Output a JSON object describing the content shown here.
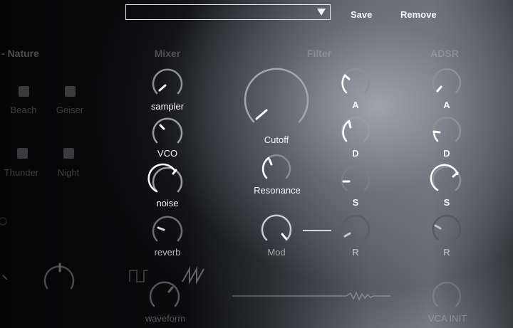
{
  "toolbar": {
    "preset_value": "",
    "save_label": "Save",
    "remove_label": "Remove"
  },
  "nature": {
    "title": "- Nature",
    "buttons": [
      "Beach",
      "Geiser",
      "Thunder",
      "Night"
    ]
  },
  "mixer": {
    "title": "Mixer",
    "knobs": [
      "sampler",
      "VCO",
      "noise",
      "reverb"
    ]
  },
  "filter": {
    "title": "Filter",
    "cutoff_label": "Cutoff",
    "resonance_label": "Resonance",
    "mod_label": "Mod",
    "env_labels": [
      "A",
      "D",
      "S",
      "R"
    ]
  },
  "adsr": {
    "title": "ADSR",
    "labels": [
      "A",
      "D",
      "S",
      "R"
    ]
  },
  "bottom": {
    "waveform_label": "waveform",
    "vca_label": "VCA INIT"
  },
  "colors": {
    "knob_track": "#8e9096",
    "knob_pointer": "#ffffff"
  }
}
